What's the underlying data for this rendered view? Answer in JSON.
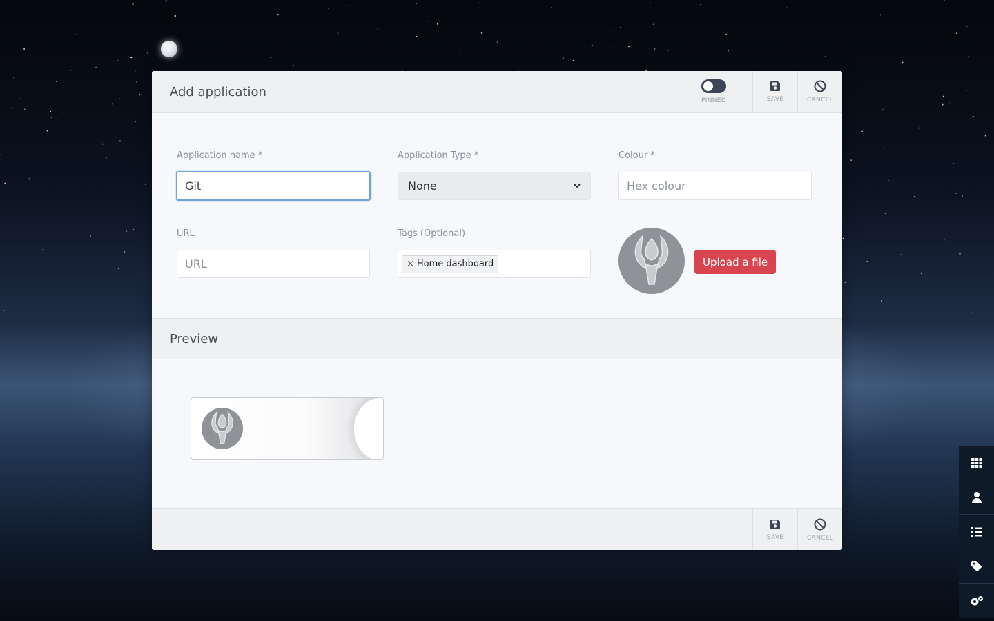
{
  "modal": {
    "title": "Add application",
    "pinned_label": "PINNED",
    "pinned_on": false,
    "save_label": "SAVE",
    "cancel_label": "CANCEL"
  },
  "form": {
    "name": {
      "label": "Application name *",
      "value": "Git"
    },
    "type": {
      "label": "Application Type *",
      "selected": "None"
    },
    "colour": {
      "label": "Colour *",
      "placeholder": "Hex colour"
    },
    "url": {
      "label": "URL",
      "placeholder": "URL"
    },
    "tags": {
      "label": "Tags (Optional)",
      "items": [
        "Home dashboard"
      ],
      "remove_glyph": "×"
    },
    "upload_label": "Upload a file"
  },
  "preview": {
    "title": "Preview"
  },
  "footer": {
    "save_label": "SAVE",
    "cancel_label": "CANCEL"
  },
  "dock": {
    "items": [
      "grid-icon",
      "user-icon",
      "list-icon",
      "tag-icon",
      "cogs-icon"
    ]
  },
  "colors": {
    "upload_button": "#d9454f",
    "focus_border": "#6ea5e0",
    "toggle": "#3d4654"
  }
}
